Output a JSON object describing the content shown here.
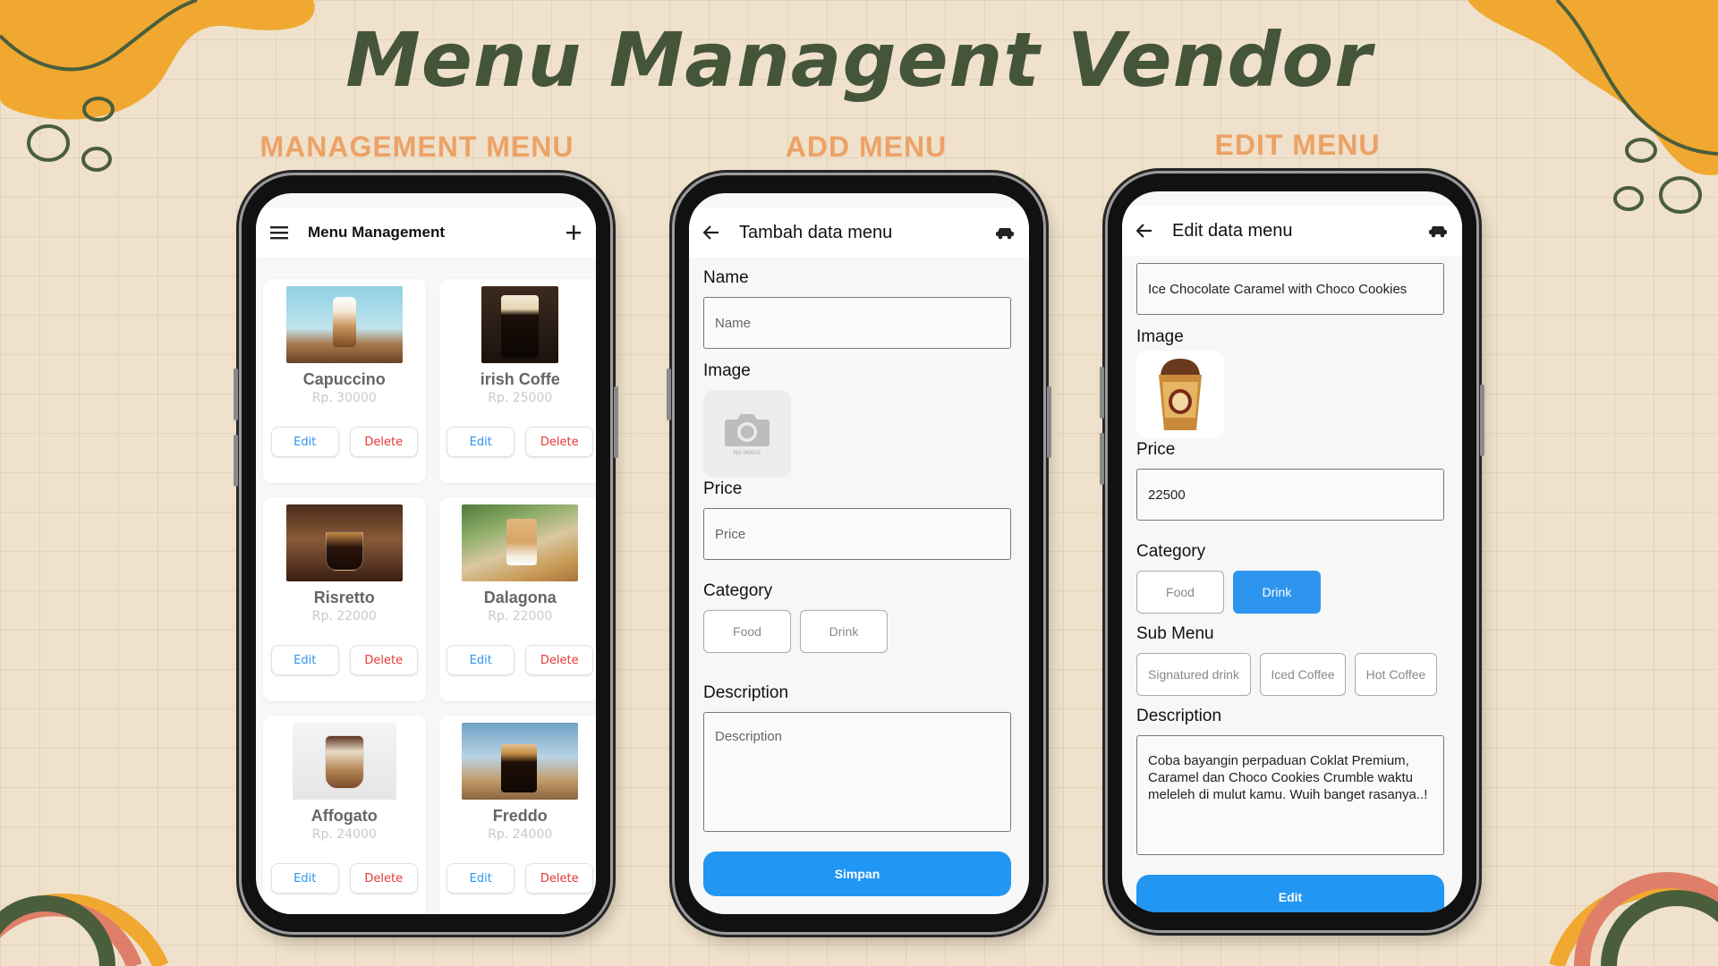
{
  "page": {
    "title": "Menu Managent Vendor"
  },
  "sections": {
    "management": "MANAGEMENT MENU",
    "add": "ADD MENU",
    "edit": "EDIT MENU"
  },
  "management_screen": {
    "title": "Menu Management",
    "items": [
      {
        "name": "Capuccino",
        "price": "Rp. 30000",
        "edit": "Edit",
        "delete": "Delete"
      },
      {
        "name": "irish Coffe",
        "price": "Rp. 25000",
        "edit": "Edit",
        "delete": "Delete"
      },
      {
        "name": "Risretto",
        "price": "Rp. 22000",
        "edit": "Edit",
        "delete": "Delete"
      },
      {
        "name": "Dalagona",
        "price": "Rp. 22000",
        "edit": "Edit",
        "delete": "Delete"
      },
      {
        "name": "Affogato",
        "price": "Rp. 24000",
        "edit": "Edit",
        "delete": "Delete"
      },
      {
        "name": "Freddo",
        "price": "Rp. 24000",
        "edit": "Edit",
        "delete": "Delete"
      }
    ]
  },
  "add_screen": {
    "title": "Tambah data menu",
    "name_label": "Name",
    "name_placeholder": "Name",
    "image_label": "Image",
    "no_image_text": "NO IMAGE",
    "price_label": "Price",
    "price_placeholder": "Price",
    "category_label": "Category",
    "categories": [
      "Food",
      "Drink"
    ],
    "description_label": "Description",
    "description_placeholder": "Description",
    "submit_label": "Simpan"
  },
  "edit_screen": {
    "title": "Edit data menu",
    "name_value": "Ice Chocolate Caramel with Choco Cookies",
    "image_label": "Image",
    "price_label": "Price",
    "price_value": "22500",
    "category_label": "Category",
    "categories": [
      "Food",
      "Drink"
    ],
    "selected_category": "Drink",
    "submenu_label": "Sub Menu",
    "submenus": [
      "Signatured drink",
      "Iced Coffee",
      "Hot Coffee"
    ],
    "description_label": "Description",
    "description_value": "Coba bayangin perpaduan Coklat Premium, Caramel dan Choco Cookies Crumble waktu meleleh di mulut kamu. Wuih banget rasanya..!",
    "submit_label": "Edit"
  },
  "colors": {
    "background": "#efe1cb",
    "title": "#44553a",
    "section_title": "#eca266",
    "accent_blue": "#2196f3",
    "delete_red": "#e53935",
    "deco_orange": "#f0a830",
    "deco_salmon": "#df7f69",
    "deco_green": "#4a5e3c"
  }
}
